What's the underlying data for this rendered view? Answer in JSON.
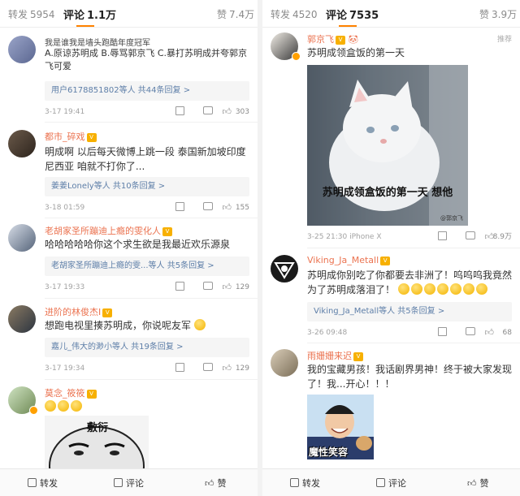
{
  "left": {
    "tabs": {
      "repost_label": "转发",
      "repost_count": "5954",
      "comment_label": "评论",
      "comment_count": "1.1万",
      "like_label": "赞",
      "like_count": "7.4万"
    },
    "comments": [
      {
        "name": "我是谁我是墙头跑酷年度冠军",
        "text": "A.原谅苏明成 B.辱骂郭京飞 C.暴打苏明成并夸郭京飞可爱",
        "reply": "用户6178851802等人 共44条回复 >",
        "time": "3-17 19:41",
        "likes": "303"
      },
      {
        "name": "都市_碎戏",
        "text": "明成啊 以后每天微博上跳一段 泰国新加坡印度尼西亚 咱就不打你了...",
        "reply": "姜姜Lonely等人 共10条回复 >",
        "time": "3-18 01:59",
        "likes": "155"
      },
      {
        "name": "老胡家圣所蹦迪上瘾的雯化人",
        "text": "哈哈哈哈哈你这个求生欲是我最近欢乐源泉",
        "reply": "老胡家圣所蹦迪上瘾的雯...等人 共5条回复 >",
        "time": "3-17 19:33",
        "likes": "129"
      },
      {
        "name": "进阶的林俊杰I",
        "text": "想跑电视里揍苏明成，你说呢友军",
        "reply": "嘉儿_伟大的渺小等人 共19条回复 >",
        "time": "3-17 19:34",
        "likes": "129"
      },
      {
        "name": "莫念_筱筱",
        "meme_text": "敷衍"
      }
    ],
    "bottom": {
      "repost": "转发",
      "comment": "评论",
      "like": "赞"
    }
  },
  "right": {
    "tabs": {
      "repost_label": "转发",
      "repost_count": "4520",
      "comment_label": "评论",
      "comment_count": "7535",
      "like_label": "赞",
      "like_count": "3.9万"
    },
    "pinned_tag": "推荐",
    "comments": [
      {
        "name": "郭京飞",
        "text": "苏明成领盒饭的第一天",
        "image_caption": "苏明成领盒饭的第一天 想他",
        "watermark": "@郭京飞",
        "time": "3-25 21:30 iPhone X",
        "likes": "8.9万"
      },
      {
        "name": "Viking_Ja_Metall",
        "text": "苏明成你别吃了你都要去非洲了！呜呜呜我竟然为了苏明成落泪了！",
        "reply": "Viking_Ja_Metall等人 共5条回复 >",
        "time": "3-26 09:48",
        "likes": "68"
      },
      {
        "name": "雨姗姗来迟",
        "text": "我的宝藏男孩！我话剧界男神！终于被大家发现了！我...开心！！！",
        "image_caption": "魔性笑容"
      }
    ],
    "bottom": {
      "repost": "转发",
      "comment": "评论",
      "like": "赞"
    }
  },
  "colors": {
    "accent": "#ff8200",
    "name": "#eb7350",
    "link": "#5d7ea8"
  }
}
